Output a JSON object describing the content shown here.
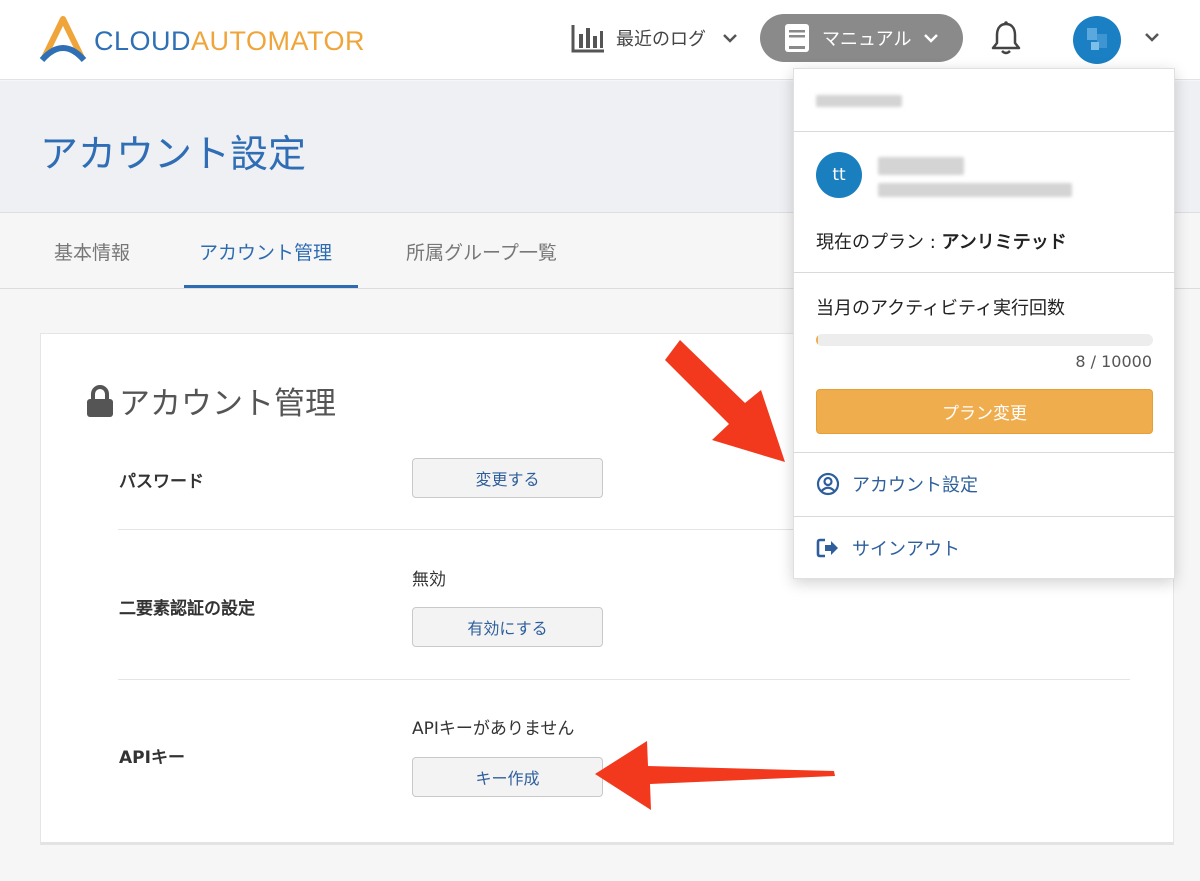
{
  "header": {
    "logo_part1": "CLOUD",
    "logo_part2": "AUTOMATOR",
    "recent_logs_label": "最近のログ",
    "manual_label": "マニュアル"
  },
  "page": {
    "title": "アカウント設定"
  },
  "tabs": [
    {
      "label": "基本情報",
      "active": false
    },
    {
      "label": "アカウント管理",
      "active": true
    },
    {
      "label": "所属グループ一覧",
      "active": false
    }
  ],
  "card": {
    "title": "アカウント管理",
    "password": {
      "label": "パスワード",
      "button": "変更する"
    },
    "two_factor": {
      "label": "二要素認証の設定",
      "status": "無効",
      "button": "有効にする"
    },
    "api_key": {
      "label": "APIキー",
      "status": "APIキーがありません",
      "button": "キー作成"
    }
  },
  "dropdown": {
    "avatar_initials": "tt",
    "plan_prefix": "現在のプラン : ",
    "plan_name": "アンリミテッド",
    "activity_label": "当月のアクティビティ実行回数",
    "activity_used": 8,
    "activity_limit": 10000,
    "activity_text": "8 / 10000",
    "change_plan_button": "プラン変更",
    "account_settings_label": "アカウント設定",
    "sign_out_label": "サインアウト"
  },
  "colors": {
    "brand_blue": "#2e6fb6",
    "brand_orange": "#f0a53a",
    "plan_button": "#f0ad4e",
    "annotation_red": "#f2391d"
  }
}
